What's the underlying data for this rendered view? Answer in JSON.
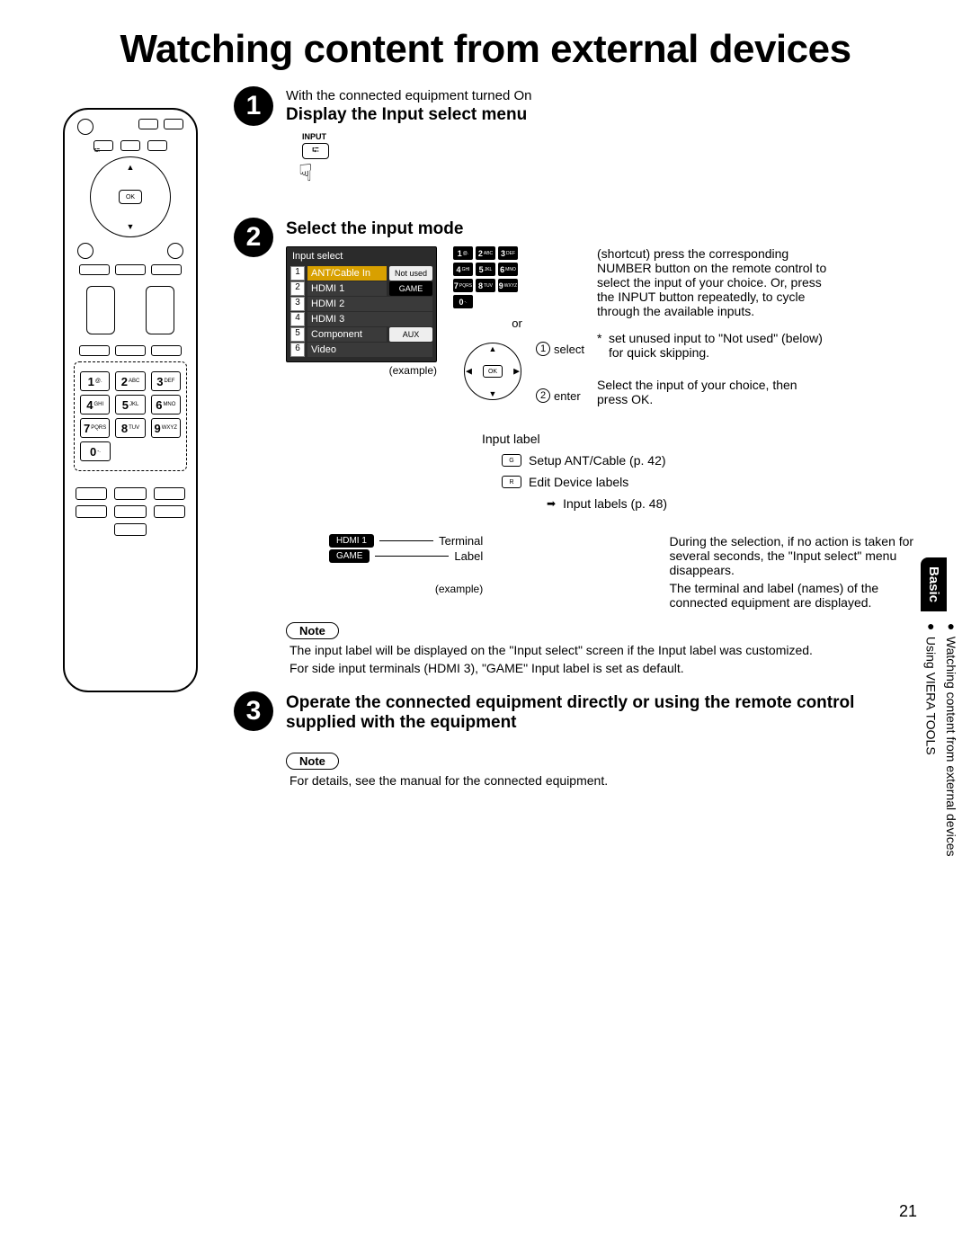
{
  "page_title": "Watching content from external devices",
  "page_number": "21",
  "side": {
    "section": "Basic",
    "items": [
      "Watching content from external devices",
      "Using VIERA TOOLS"
    ]
  },
  "remote": {
    "ok": "OK",
    "keys": {
      "1": {
        "n": "1",
        "s": "@."
      },
      "2": {
        "n": "2",
        "s": "ABC"
      },
      "3": {
        "n": "3",
        "s": "DEF"
      },
      "4": {
        "n": "4",
        "s": "GHI"
      },
      "5": {
        "n": "5",
        "s": "JKL"
      },
      "6": {
        "n": "6",
        "s": "MNO"
      },
      "7": {
        "n": "7",
        "s": "PQRS"
      },
      "8": {
        "n": "8",
        "s": "TUV"
      },
      "9": {
        "n": "9",
        "s": "WXYZ"
      },
      "0": {
        "n": "0",
        "s": "-."
      }
    }
  },
  "step1": {
    "num": "1",
    "pre": "With the connected equipment turned On",
    "title": "Display the Input select menu",
    "input_label": "INPUT",
    "input_symbol": "⮓"
  },
  "step2": {
    "num": "2",
    "title": "Select the input mode",
    "dlg_title": "Input select",
    "rows": [
      {
        "n": "1",
        "name": "ANT/Cable In",
        "tag": "Not used",
        "tagwhite": true,
        "sel": true
      },
      {
        "n": "2",
        "name": "HDMI 1",
        "tag": "GAME"
      },
      {
        "n": "3",
        "name": "HDMI 2"
      },
      {
        "n": "4",
        "name": "HDMI 3"
      },
      {
        "n": "5",
        "name": "Component",
        "tag": "AUX",
        "tagwhite": true
      },
      {
        "n": "6",
        "name": "Video"
      }
    ],
    "example": "(example)",
    "or": "or",
    "select_lbl": "select",
    "enter_lbl": "enter",
    "numkeys_sub": {
      "1": "@.",
      "2": "ABC",
      "3": "DEF",
      "4": "GHI",
      "5": "JKL",
      "6": "MNO",
      "7": "PQRS",
      "8": "TUV",
      "9": "WXYZ",
      "0": "-."
    },
    "right": {
      "p1": "(shortcut) press the corresponding NUMBER button on the remote control to select the input of your choice. Or, press the INPUT button repeatedly, to cycle through the available inputs.",
      "star": "set unused input to \"Not used\" (below) for quick skipping.",
      "p2": "Select the input of your choice, then press OK."
    },
    "inputlabel": {
      "head": "Input label",
      "g": "G",
      "g_text": "Setup ANT/Cable (p. 42)",
      "r": "R",
      "r_text": "Edit Device labels",
      "sub": "Input labels (p. 48)"
    },
    "terminal": {
      "hdmi": "HDMI 1",
      "game": "GAME",
      "term_lbl": "Terminal",
      "label_lbl": "Label",
      "example": "(example)",
      "right1": "During the selection, if no action is taken for several seconds, the \"Input select\" menu disappears.",
      "right2": "The terminal and label (names) of the connected equipment are displayed."
    },
    "note_label": "Note",
    "note1": "The input label will be displayed on the \"Input select\" screen if the Input label was customized.",
    "note2": "For side input terminals (HDMI 3), \"GAME\" Input label is set as default."
  },
  "step3": {
    "num": "3",
    "title": "Operate the connected equipment directly or using the remote control supplied with the equipment",
    "note_label": "Note",
    "note": "For details, see the manual for the connected equipment."
  }
}
